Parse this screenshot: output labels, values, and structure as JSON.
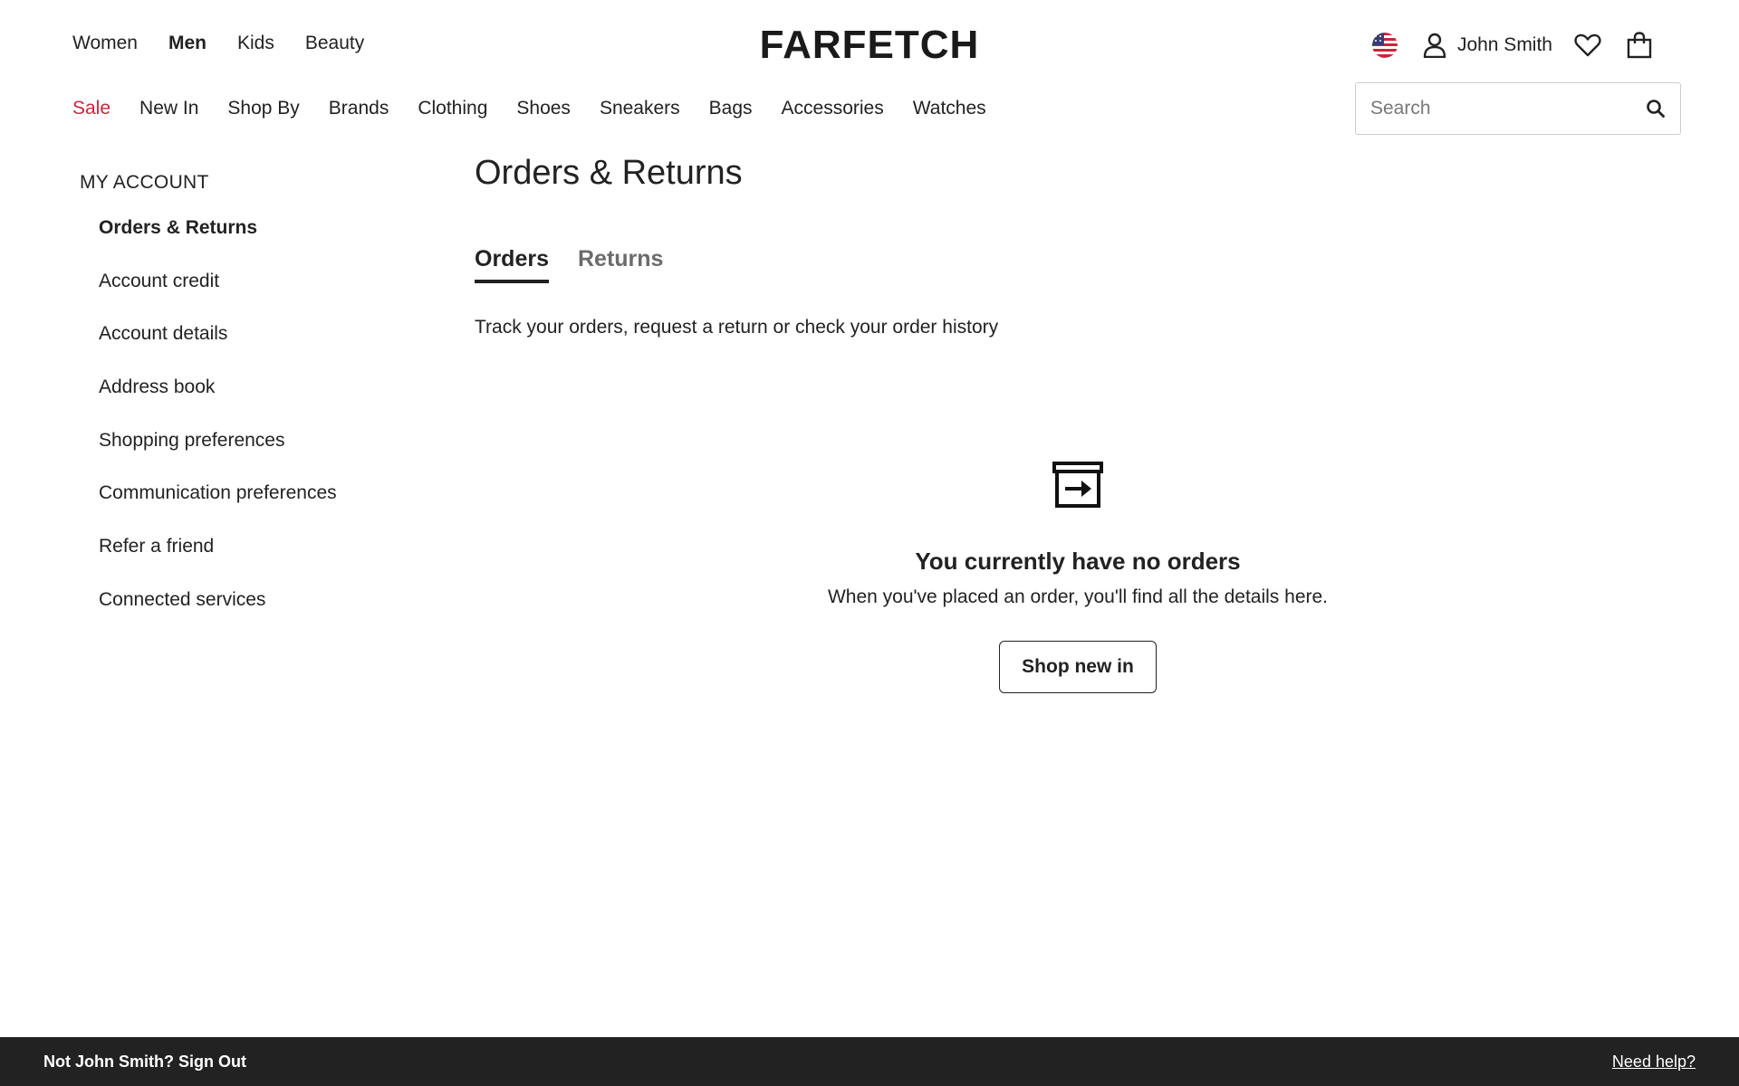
{
  "header": {
    "departments": [
      {
        "label": "Women",
        "active": false
      },
      {
        "label": "Men",
        "active": true
      },
      {
        "label": "Kids",
        "active": false
      },
      {
        "label": "Beauty",
        "active": false
      }
    ],
    "logo": "FARFETCH",
    "user_name": "John Smith",
    "icons": {
      "region": "us-flag-icon",
      "account": "user-icon",
      "wishlist": "heart-icon",
      "bag": "shopping-bag-icon",
      "search": "search-icon"
    },
    "categories": [
      "Sale",
      "New In",
      "Shop By",
      "Brands",
      "Clothing",
      "Shoes",
      "Sneakers",
      "Bags",
      "Accessories",
      "Watches"
    ],
    "search": {
      "placeholder": "Search"
    }
  },
  "sidebar": {
    "heading": "MY ACCOUNT",
    "items": [
      {
        "label": "Orders & Returns",
        "active": true
      },
      {
        "label": "Account credit",
        "active": false
      },
      {
        "label": "Account details",
        "active": false
      },
      {
        "label": "Address book",
        "active": false
      },
      {
        "label": "Shopping preferences",
        "active": false
      },
      {
        "label": "Communication preferences",
        "active": false
      },
      {
        "label": "Refer a friend",
        "active": false
      },
      {
        "label": "Connected services",
        "active": false
      }
    ]
  },
  "main": {
    "title": "Orders & Returns",
    "tabs": [
      {
        "label": "Orders",
        "active": true
      },
      {
        "label": "Returns",
        "active": false
      }
    ],
    "intro": "Track your orders, request a return or check your order history",
    "empty_state": {
      "icon": "archive-box-icon",
      "title": "You currently have no orders",
      "subtitle": "When you've placed an order, you'll find all the details here.",
      "button": "Shop new in"
    }
  },
  "footer": {
    "signout": "Not John Smith? Sign Out",
    "help": "Need help?"
  },
  "colors": {
    "sale": "#c8263b",
    "text": "#222222",
    "muted": "#6b6b6b",
    "footer_bg": "#222222"
  }
}
